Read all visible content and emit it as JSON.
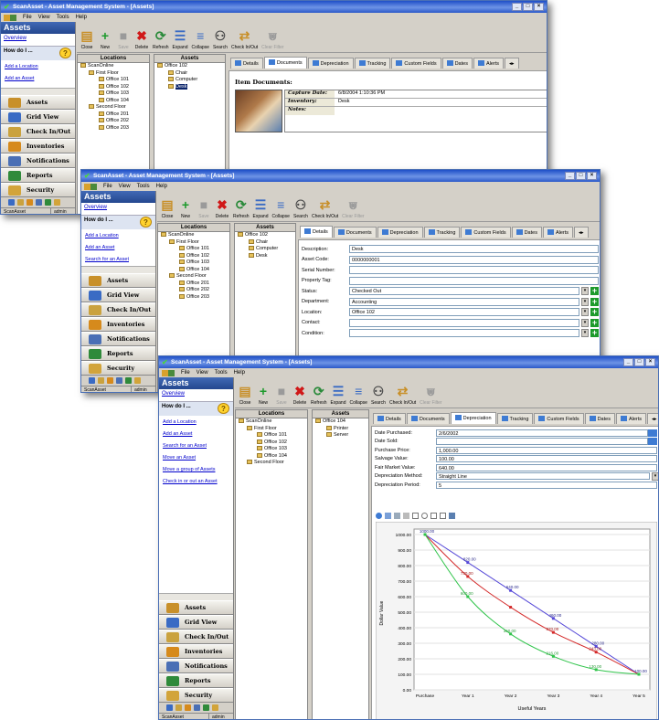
{
  "app": {
    "title": "ScanAsset - Asset Management System - [Assets]",
    "menu": [
      "File",
      "View",
      "Tools",
      "Help"
    ],
    "window_controls": [
      "_",
      "×"
    ]
  },
  "nav": {
    "title": "Assets",
    "overview": "Overview",
    "how_do_i": "How do I ...",
    "links": [
      "Add a Location",
      "Add an Asset",
      "Search for an Asset",
      "Move an Asset",
      "Move a group of Assets",
      "Check in or out an Asset"
    ],
    "buttons": [
      {
        "label": "Assets",
        "color": "#c8902a"
      },
      {
        "label": "Grid View",
        "color": "#3a6bc4"
      },
      {
        "label": "Check In/Out",
        "color": "#caa23e"
      },
      {
        "label": "Inventories",
        "color": "#d68a1c"
      },
      {
        "label": "Notifications",
        "color": "#4a6fb5"
      },
      {
        "label": "Reports",
        "color": "#2f8a3a"
      },
      {
        "label": "Security",
        "color": "#d2a43a"
      }
    ]
  },
  "status": {
    "left": "ScanAsset",
    "right": "admin"
  },
  "toolbar": [
    {
      "label": "Close",
      "icon": "folder-icon",
      "glyph": "▤",
      "color": "#c8902a",
      "enabled": true
    },
    {
      "label": "New",
      "icon": "plus-icon",
      "glyph": "+",
      "color": "#1d9a2c",
      "enabled": true
    },
    {
      "label": "Save",
      "icon": "save-icon",
      "glyph": "■",
      "color": "#9a9a9a",
      "enabled": false
    },
    {
      "label": "Delete",
      "icon": "delete-icon",
      "glyph": "✖",
      "color": "#d01818",
      "enabled": true
    },
    {
      "label": "Refresh",
      "icon": "refresh-icon",
      "glyph": "⟳",
      "color": "#2a8a3a",
      "enabled": true
    },
    {
      "label": "Expand",
      "icon": "expand-icon",
      "glyph": "☰",
      "color": "#3a6bc4",
      "enabled": true
    },
    {
      "label": "Collapse",
      "icon": "collapse-icon",
      "glyph": "≡",
      "color": "#3a6bc4",
      "enabled": true
    },
    {
      "label": "Search",
      "icon": "binoculars-icon",
      "glyph": "⚇",
      "color": "#4a4a4a",
      "enabled": true
    },
    {
      "label": "Check In/Out",
      "icon": "check-in-out-icon",
      "glyph": "⇄",
      "color": "#c8902a",
      "enabled": true
    },
    {
      "label": "Clear Filter",
      "icon": "filter-icon",
      "glyph": "⩐",
      "color": "#9a9a9a",
      "enabled": false
    }
  ],
  "locations_header": "Locations",
  "assets_header": "Assets",
  "tabs": [
    "Details",
    "Documents",
    "Depreciation",
    "Tracking",
    "Custom Fields",
    "Dates",
    "Alerts"
  ],
  "w1": {
    "locations": [
      "ScanOnline",
      "First Floor",
      "Office 101",
      "Office 102",
      "Office 103",
      "Office 104",
      "Second Floor",
      "Office 201",
      "Office 202",
      "Office 203"
    ],
    "assets": [
      "Office 102",
      "Chair",
      "Computer",
      "Desk"
    ],
    "selected_asset": "Desk",
    "documents": {
      "title": "Item Documents:",
      "capture_date_label": "Capture Date:",
      "capture_date": "6/8/2004 1:10:36 PM",
      "inventory_label": "Inventory:",
      "inventory": "Desk",
      "notes_label": "Notes:",
      "notes": ""
    }
  },
  "w2": {
    "locations": [
      "ScanOnline",
      "First Floor",
      "Office 101",
      "Office 102",
      "Office 103",
      "Office 104",
      "Second Floor",
      "Office 201",
      "Office 202",
      "Office 203"
    ],
    "assets": [
      "Office 102",
      "Chair",
      "Computer",
      "Desk"
    ],
    "fields": [
      {
        "label": "Description:",
        "value": "Desk"
      },
      {
        "label": "Asset Code:",
        "value": "0000000001"
      },
      {
        "label": "Serial Number:",
        "value": ""
      },
      {
        "label": "Property Tag:",
        "value": ""
      },
      {
        "label": "Status:",
        "value": "Checked Out"
      },
      {
        "label": "Department:",
        "value": "Accounting"
      },
      {
        "label": "Location:",
        "value": "Office 102"
      },
      {
        "label": "Contact:",
        "value": ""
      },
      {
        "label": "Condition:",
        "value": ""
      }
    ]
  },
  "w3": {
    "locations": [
      "ScanOnline",
      "First Floor",
      "Office 101",
      "Office 102",
      "Office 103",
      "Office 104",
      "Second Floor"
    ],
    "assets": [
      "Office 104",
      "Printer",
      "Server"
    ],
    "fields": [
      {
        "label": "Date Purchased:",
        "value": "2/6/2002"
      },
      {
        "label": "Date Sold:",
        "value": ""
      },
      {
        "label": "Purchase Price:",
        "value": "1,000.00"
      },
      {
        "label": "Salvage Value:",
        "value": "100.00"
      },
      {
        "label": "Fair Market Value:",
        "value": "640.00"
      },
      {
        "label": "Depreciation Method:",
        "value": "Straight Line"
      },
      {
        "label": "Depreciation Period:",
        "value": "5"
      }
    ]
  },
  "chart_data": {
    "type": "line",
    "categories": [
      "Purchase",
      "Year 1",
      "Year 2",
      "Year 3",
      "Year 4",
      "Year 5"
    ],
    "xlabel": "Useful Years",
    "ylabel": "Dollar Value",
    "ylim": [
      0,
      1000
    ],
    "yticks": [
      "0.00",
      "100.00",
      "200.00",
      "300.00",
      "400.00",
      "500.00",
      "600.00",
      "700.00",
      "800.00",
      "900.00",
      "1000.00"
    ],
    "series": [
      {
        "color": "#5548d8",
        "values": [
          1000,
          820,
          640,
          460,
          280,
          100
        ],
        "labels": [
          "1000.00",
          "820.00",
          "640.00",
          "460.00",
          "280.00",
          "100.00"
        ]
      },
      {
        "color": "#d42a2a",
        "values": [
          1000,
          730,
          532,
          370,
          243,
          100
        ],
        "labels": [
          "",
          "730.00",
          "",
          "370.00",
          "243.00",
          ""
        ]
      },
      {
        "color": "#2fc44a",
        "values": [
          1000,
          600,
          360,
          216,
          130,
          100
        ],
        "labels": [
          "",
          "600.00",
          "360.00",
          "216.00",
          "130.00",
          ""
        ]
      }
    ]
  }
}
